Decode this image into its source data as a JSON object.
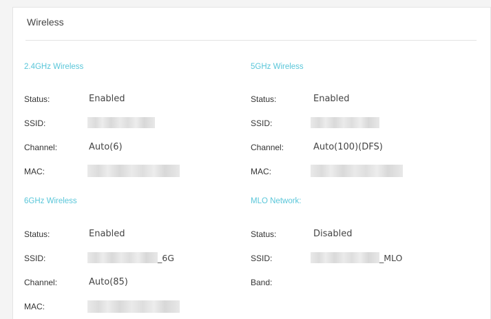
{
  "panel": {
    "title": "Wireless"
  },
  "sections": {
    "g24": {
      "title": "2.4GHz Wireless",
      "status_label": "Status:",
      "status_value": "Enabled",
      "ssid_label": "SSID:",
      "channel_label": "Channel:",
      "channel_value": "Auto(6)",
      "mac_label": "MAC:"
    },
    "g5": {
      "title": "5GHz Wireless",
      "status_label": "Status:",
      "status_value": "Enabled",
      "ssid_label": "SSID:",
      "channel_label": "Channel:",
      "channel_value": "Auto(100)(DFS)",
      "mac_label": "MAC:"
    },
    "g6": {
      "title": "6GHz Wireless",
      "status_label": "Status:",
      "status_value": "Enabled",
      "ssid_label": "SSID:",
      "ssid_suffix": "_6G",
      "channel_label": "Channel:",
      "channel_value": "Auto(85)",
      "mac_label": "MAC:"
    },
    "mlo": {
      "title": "MLO Network:",
      "status_label": "Status:",
      "status_value": "Disabled",
      "ssid_label": "SSID:",
      "ssid_suffix": "_MLO",
      "band_label": "Band:"
    }
  },
  "colors": {
    "section_title": "#59c6d9",
    "label": "#333333",
    "value": "#444444"
  }
}
